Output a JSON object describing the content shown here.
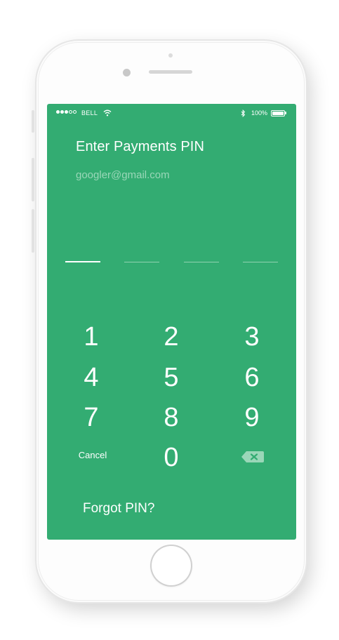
{
  "status_bar": {
    "signal_icon": "signal-dots-icon",
    "carrier": "BELL",
    "wifi_icon": "wifi-icon",
    "bluetooth_icon": "bluetooth-icon",
    "battery_percent": "100%",
    "battery_icon": "battery-icon"
  },
  "header": {
    "title": "Enter Payments PIN",
    "email": "googler@gmail.com"
  },
  "pin": {
    "length": 4,
    "entered": 0
  },
  "keypad": {
    "keys": [
      "1",
      "2",
      "3",
      "4",
      "5",
      "6",
      "7",
      "8",
      "9"
    ],
    "zero": "0",
    "cancel": "Cancel",
    "backspace_icon": "backspace-icon"
  },
  "footer": {
    "forgot": "Forgot PIN?"
  },
  "colors": {
    "screen_bg": "#33ac72",
    "text": "#ffffff",
    "muted_text": "#9ad7b8"
  }
}
